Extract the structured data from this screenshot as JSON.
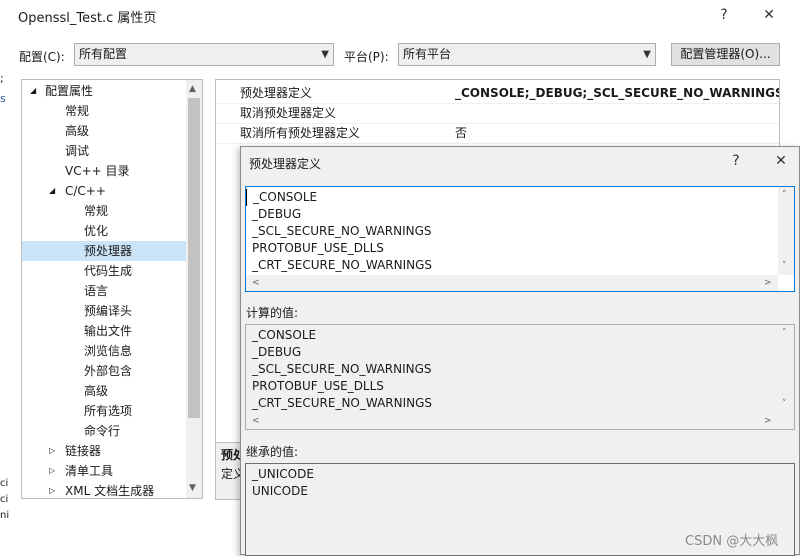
{
  "window": {
    "title": "Openssl_Test.c 属性页",
    "help_glyph": "?",
    "close_glyph": "✕"
  },
  "config_bar": {
    "config_label": "配置(C):",
    "config_value": "所有配置",
    "platform_label": "平台(P):",
    "platform_value": "所有平台",
    "manager_button": "配置管理器(O)..."
  },
  "tree": {
    "items": [
      {
        "label": "配置属性",
        "expander": "◢"
      },
      {
        "label": "常规"
      },
      {
        "label": "高级"
      },
      {
        "label": "调试"
      },
      {
        "label": "VC++ 目录"
      },
      {
        "label": "C/C++",
        "expander": "◢"
      },
      {
        "label": "常规"
      },
      {
        "label": "优化"
      },
      {
        "label": "预处理器"
      },
      {
        "label": "代码生成"
      },
      {
        "label": "语言"
      },
      {
        "label": "预编译头"
      },
      {
        "label": "输出文件"
      },
      {
        "label": "浏览信息"
      },
      {
        "label": "外部包含"
      },
      {
        "label": "高级"
      },
      {
        "label": "所有选项"
      },
      {
        "label": "命令行"
      },
      {
        "label": "链接器",
        "expander": "▷"
      },
      {
        "label": "清单工具",
        "expander": "▷"
      },
      {
        "label": "XML 文档生成器",
        "expander": "▷"
      }
    ]
  },
  "grid": {
    "rows": [
      {
        "name": "预处理器定义",
        "value": "_CONSOLE;_DEBUG;_SCL_SECURE_NO_WARNINGS;PRO"
      },
      {
        "name": "取消预处理器定义",
        "value": ""
      },
      {
        "name": "取消所有预处理器定义",
        "value": "否"
      }
    ],
    "desc_title": "预处",
    "desc_text": "定义"
  },
  "left_strip": {
    "a": ";",
    "b": "s",
    "c": "ci",
    "d": "ci",
    "e": "ni"
  },
  "dialog": {
    "title": "预处理器定义",
    "help_glyph": "?",
    "close_glyph": "✕",
    "edit_lines": [
      "_CONSOLE",
      "_DEBUG",
      "_SCL_SECURE_NO_WARNINGS",
      "PROTOBUF_USE_DLLS",
      "_CRT_SECURE_NO_WARNINGS"
    ],
    "computed_label": "计算的值:",
    "computed_lines": [
      "_CONSOLE",
      "_DEBUG",
      "_SCL_SECURE_NO_WARNINGS",
      "PROTOBUF_USE_DLLS",
      "_CRT_SECURE_NO_WARNINGS"
    ],
    "inherited_label": "继承的值:",
    "inherited_lines": [
      "_UNICODE",
      "UNICODE"
    ]
  },
  "watermark": "CSDN @大大枫"
}
